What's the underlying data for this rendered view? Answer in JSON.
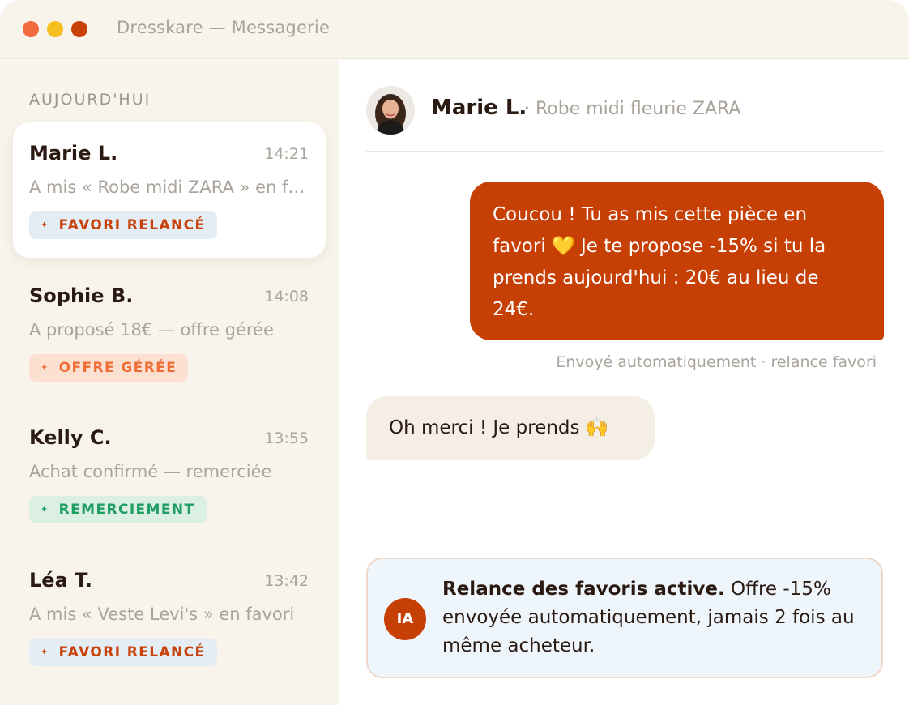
{
  "window": {
    "title": "Dresskare — Messagerie"
  },
  "sidebar": {
    "section_label": "AUJOURD'HUI",
    "conversations": [
      {
        "name": "Marie L.",
        "time": "14:21",
        "preview": "A mis « Robe midi ZARA » en favori",
        "tag": "FAVORI RELANCÉ",
        "tag_color": "#c8400a",
        "tag_bg": "#e4edf3",
        "active": true
      },
      {
        "name": "Sophie B.",
        "time": "14:08",
        "preview": "A proposé 18€ — offre gérée",
        "tag": "OFFRE GÉRÉE",
        "tag_color": "#ef6e36",
        "tag_bg": "#fbe0d2",
        "active": false
      },
      {
        "name": "Kelly C.",
        "time": "13:55",
        "preview": "Achat confirmé — remerciée",
        "tag": "REMERCIEMENT",
        "tag_color": "#1f9e63",
        "tag_bg": "#dcefe3",
        "active": false
      },
      {
        "name": "Léa T.",
        "time": "13:42",
        "preview": "A mis « Veste Levi's » en favori",
        "tag": "FAVORI RELANCÉ",
        "tag_color": "#c8400a",
        "tag_bg": "#e4edf3",
        "active": false
      }
    ]
  },
  "chat": {
    "contact_name": "Marie L.",
    "separator": "·",
    "item": "Robe midi fleurie ZARA",
    "outgoing_message": "Coucou ! Tu as mis cette pièce en favori 💛 Je te propose -15% si tu la prends aujourd'hui : 20€ au lieu de 24€.",
    "outgoing_meta": "Envoyé automatiquement · relance favori",
    "incoming_message": "Oh merci ! Je prends 🙌",
    "ai_card": {
      "badge": "IA",
      "title": "Relance des favoris active.",
      "body": " Offre -15% envoyée automatiquement, jamais 2 fois au même acheteur."
    }
  },
  "colors": {
    "accent": "#c63f04",
    "sidebar_bg": "#f8f4ec",
    "text_dark": "#2a1a12",
    "text_muted": "#a8a39b"
  },
  "icons": {
    "tag": "sparkle-icon",
    "avatar": "user-photo"
  }
}
